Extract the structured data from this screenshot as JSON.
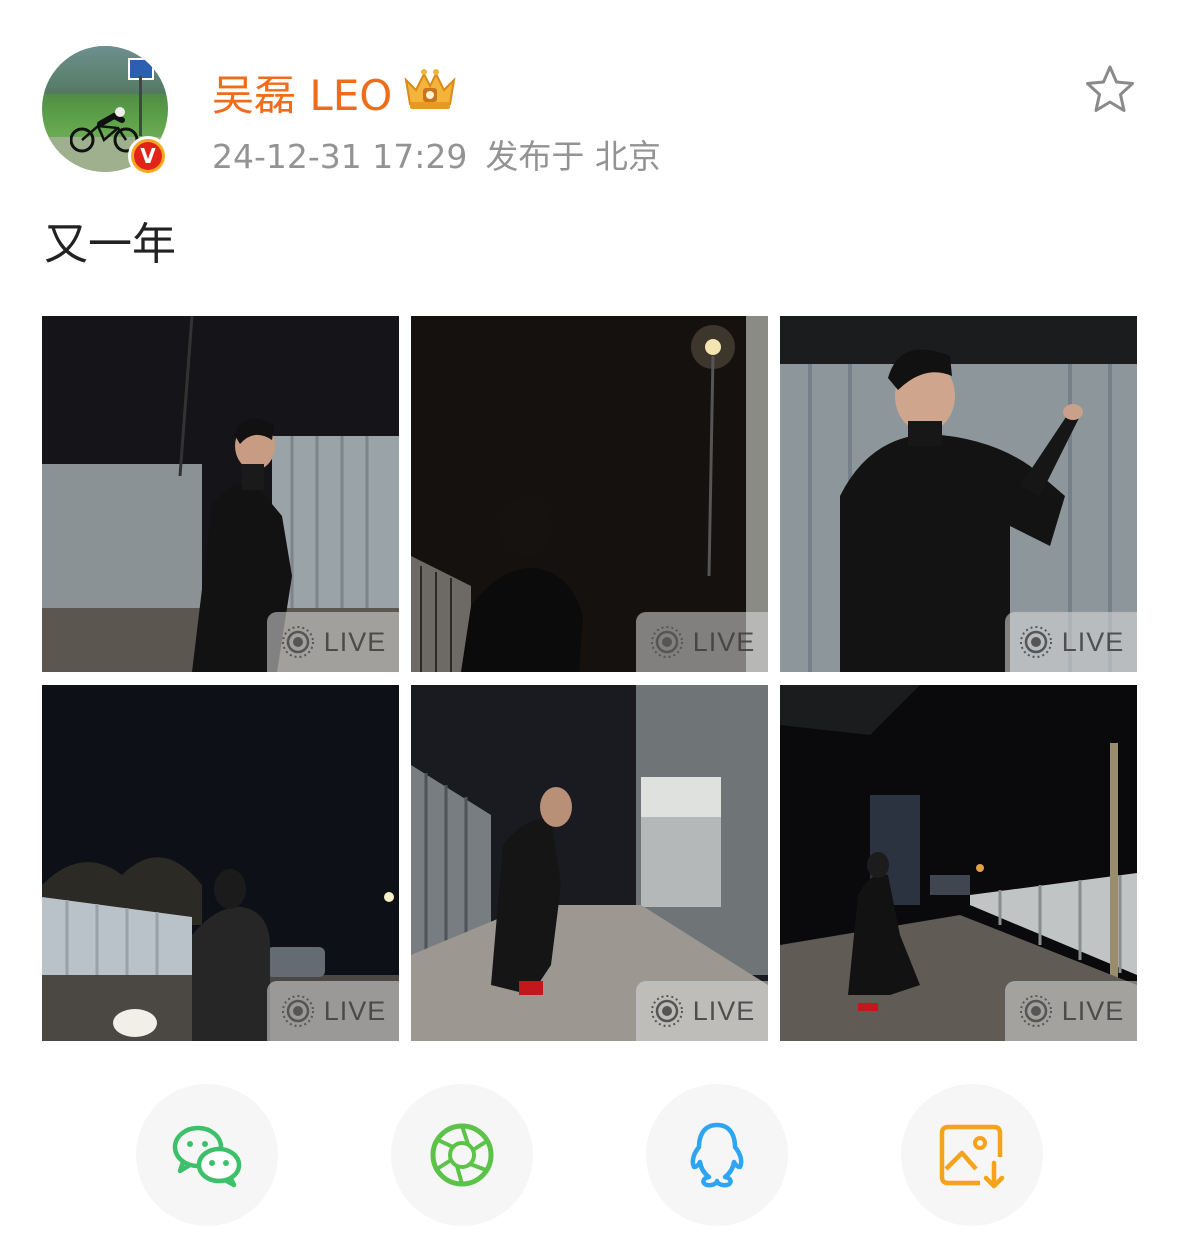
{
  "post": {
    "username": "吴磊 LEO",
    "timestamp": "24-12-31 17:29",
    "location": "发布于 北京",
    "text": "又一年",
    "verified_mark": "V"
  },
  "photos": [
    {
      "badge": "LIVE"
    },
    {
      "badge": "LIVE"
    },
    {
      "badge": "LIVE"
    },
    {
      "badge": "LIVE"
    },
    {
      "badge": "LIVE"
    },
    {
      "badge": "LIVE"
    }
  ],
  "icons": {
    "favorite": "star-icon",
    "member": "crown-icon",
    "live": "live-photo-icon",
    "share": [
      "wechat-icon",
      "moments-icon",
      "qq-icon",
      "save-image-icon"
    ]
  },
  "colors": {
    "username": "#f06c1a",
    "meta": "#939393",
    "wechat": "#3cc06a",
    "moments": "#5cc24a",
    "qq": "#2da5f3",
    "save": "#f7a21b"
  }
}
